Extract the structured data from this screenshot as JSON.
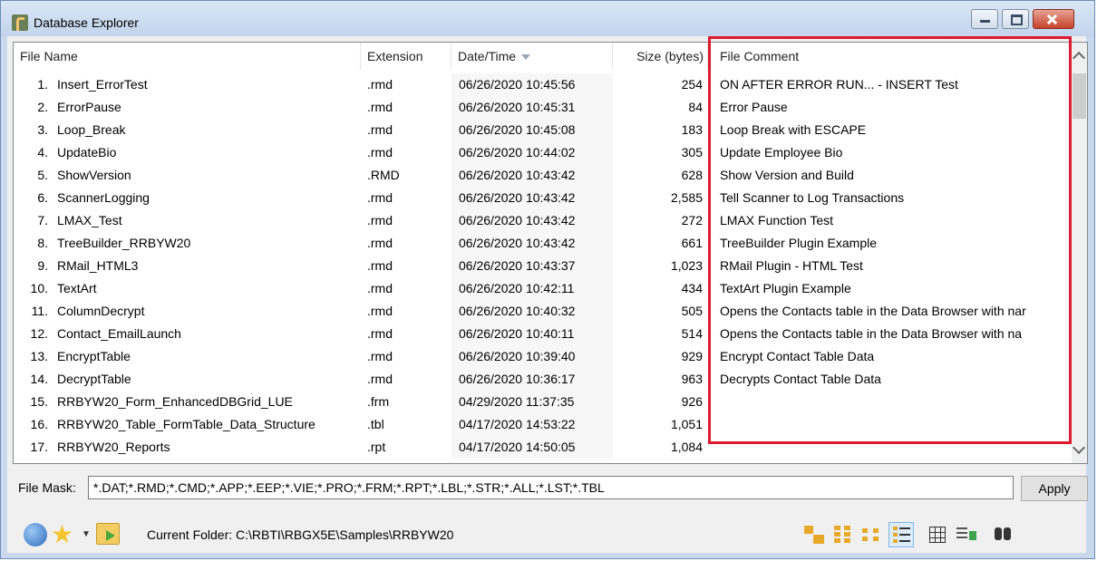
{
  "window": {
    "title": "Database Explorer"
  },
  "columns": {
    "file_name": "File Name",
    "extension": "Extension",
    "date_time": "Date/Time",
    "size": "Size (bytes)",
    "comment": "File Comment"
  },
  "rows": [
    {
      "num": "1.",
      "name": "Insert_ErrorTest",
      "ext": ".rmd",
      "date": "06/26/2020 10:45:56",
      "size": "254",
      "comment": " ON AFTER ERROR RUN... - INSERT Test"
    },
    {
      "num": "2.",
      "name": "ErrorPause",
      "ext": ".rmd",
      "date": "06/26/2020 10:45:31",
      "size": "84",
      "comment": "Error Pause"
    },
    {
      "num": "3.",
      "name": "Loop_Break",
      "ext": ".rmd",
      "date": "06/26/2020 10:45:08",
      "size": "183",
      "comment": "Loop Break with ESCAPE"
    },
    {
      "num": "4.",
      "name": "UpdateBio",
      "ext": ".rmd",
      "date": "06/26/2020 10:44:02",
      "size": "305",
      "comment": "Update Employee Bio"
    },
    {
      "num": "5.",
      "name": "ShowVersion",
      "ext": ".RMD",
      "date": "06/26/2020 10:43:42",
      "size": "628",
      "comment": "Show Version and Build"
    },
    {
      "num": "6.",
      "name": "ScannerLogging",
      "ext": ".rmd",
      "date": "06/26/2020 10:43:42",
      "size": "2,585",
      "comment": "Tell Scanner to Log Transactions"
    },
    {
      "num": "7.",
      "name": "LMAX_Test",
      "ext": ".rmd",
      "date": "06/26/2020 10:43:42",
      "size": "272",
      "comment": "LMAX Function Test"
    },
    {
      "num": "8.",
      "name": "TreeBuilder_RRBYW20",
      "ext": ".rmd",
      "date": "06/26/2020 10:43:42",
      "size": "661",
      "comment": "TreeBuilder Plugin Example"
    },
    {
      "num": "9.",
      "name": "RMail_HTML3",
      "ext": ".rmd",
      "date": "06/26/2020 10:43:37",
      "size": "1,023",
      "comment": "RMail Plugin - HTML Test"
    },
    {
      "num": "10.",
      "name": "TextArt",
      "ext": ".rmd",
      "date": "06/26/2020 10:42:11",
      "size": "434",
      "comment": "TextArt Plugin Example"
    },
    {
      "num": "11.",
      "name": "ColumnDecrypt",
      "ext": ".rmd",
      "date": "06/26/2020 10:40:32",
      "size": "505",
      "comment": "Opens the Contacts table in the Data Browser with nar"
    },
    {
      "num": "12.",
      "name": "Contact_EmailLaunch",
      "ext": ".rmd",
      "date": "06/26/2020 10:40:11",
      "size": "514",
      "comment": " Opens the Contacts table in the Data Browser with na"
    },
    {
      "num": "13.",
      "name": "EncryptTable",
      "ext": ".rmd",
      "date": "06/26/2020 10:39:40",
      "size": "929",
      "comment": "Encrypt Contact Table Data"
    },
    {
      "num": "14.",
      "name": "DecryptTable",
      "ext": ".rmd",
      "date": "06/26/2020 10:36:17",
      "size": "963",
      "comment": "Decrypts Contact Table Data"
    },
    {
      "num": "15.",
      "name": "RRBYW20_Form_EnhancedDBGrid_LUE",
      "ext": ".frm",
      "date": "04/29/2020 11:37:35",
      "size": "926",
      "comment": ""
    },
    {
      "num": "16.",
      "name": "RRBYW20_Table_FormTable_Data_Structure",
      "ext": ".tbl",
      "date": "04/17/2020 14:53:22",
      "size": "1,051",
      "comment": ""
    },
    {
      "num": "17.",
      "name": "RRBYW20_Reports",
      "ext": ".rpt",
      "date": "04/17/2020 14:50:05",
      "size": "1,084",
      "comment": ""
    }
  ],
  "file_mask": {
    "label": "File Mask:",
    "value": "*.DAT;*.RMD;*.CMD;*.APP;*.EEP;*.VIE;*.PRO;*.FRM;*.RPT;*.LBL;*.STR;*.ALL;*.LST;*.TBL",
    "apply_label": "Apply"
  },
  "status": {
    "current_folder": "Current Folder: C:\\RBTI\\RBGX5E\\Samples\\RRBYW20"
  },
  "colors": {
    "highlight": "#e0192e",
    "date_column_bg": "#f7f7f7"
  },
  "icons": [
    "database-icon",
    "favorites-star-icon",
    "dropdown-caret-icon",
    "open-folder-icon",
    "large-icons-view-icon",
    "small-icons-view-icon",
    "list-view-icon",
    "details-view-icon",
    "grid-view-icon",
    "refresh-view-icon",
    "find-binoculars-icon"
  ]
}
